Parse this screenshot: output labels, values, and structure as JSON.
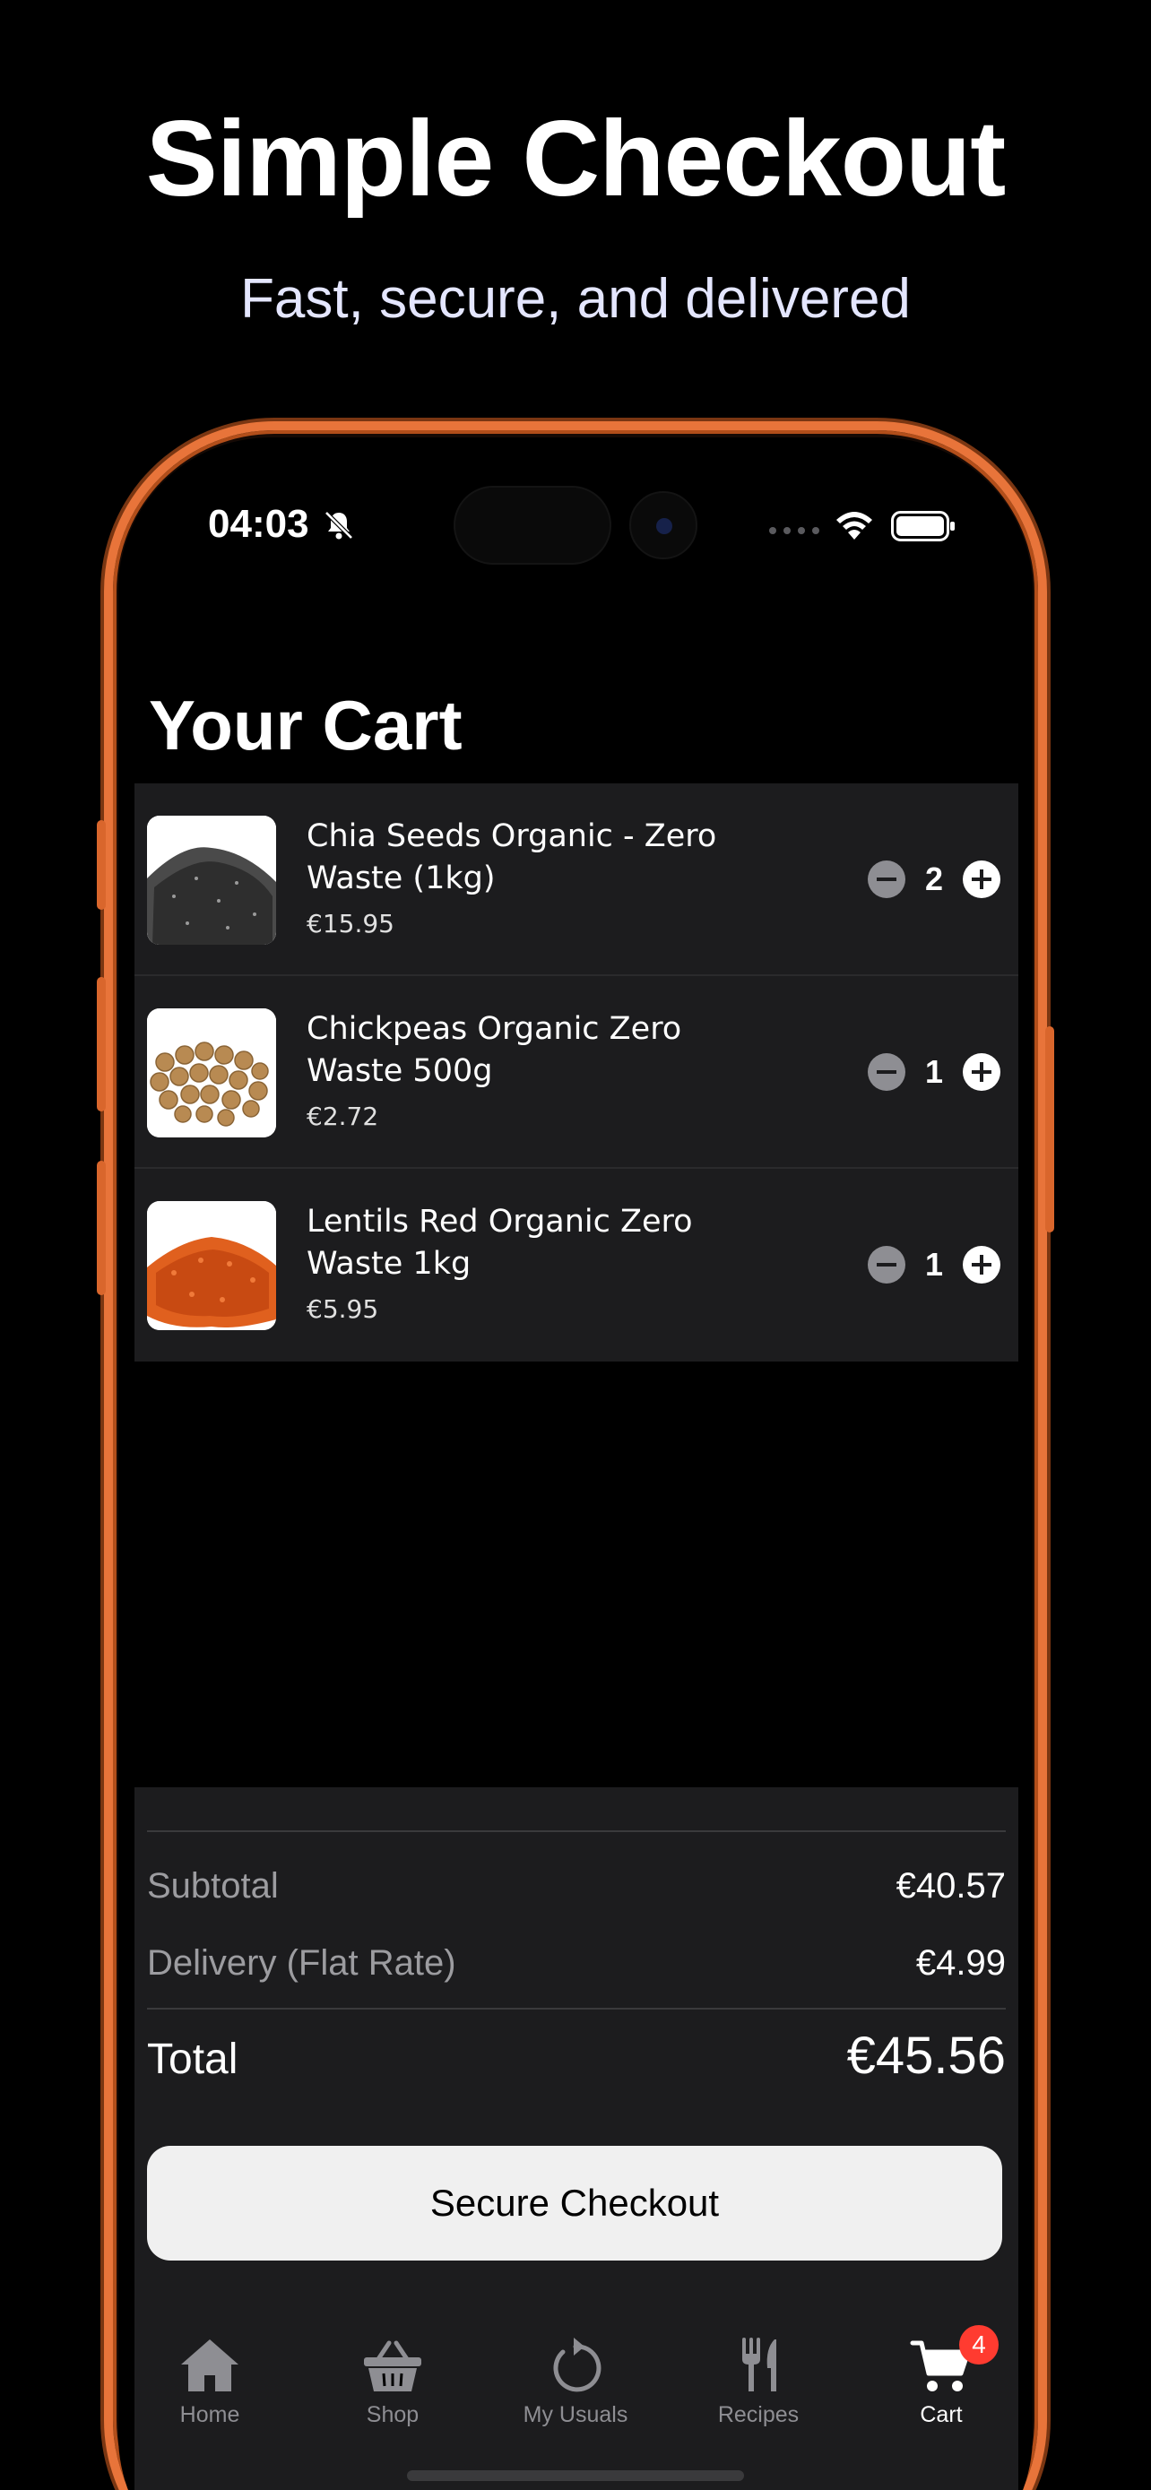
{
  "hero": {
    "title": "Simple Checkout",
    "subtitle": "Fast, secure, and delivered"
  },
  "status_bar": {
    "time": "04:03",
    "silent_icon": "bell-slash-icon",
    "signal_icon": "cellular-dots-icon",
    "wifi_icon": "wifi-icon",
    "battery_icon": "battery-full-icon"
  },
  "cart": {
    "title": "Your Cart",
    "items": [
      {
        "name": "Chia Seeds Organic - Zero Waste (1kg)",
        "price": "€15.95",
        "quantity": "2",
        "image": "chia-seeds-image"
      },
      {
        "name": "Chickpeas Organic Zero Waste 500g",
        "price": "€2.72",
        "quantity": "1",
        "image": "chickpeas-image"
      },
      {
        "name": "Lentils Red Organic Zero Waste 1kg",
        "price": "€5.95",
        "quantity": "1",
        "image": "red-lentils-image"
      }
    ]
  },
  "summary": {
    "subtotal_label": "Subtotal",
    "subtotal_value": "€40.57",
    "delivery_label": "Delivery (Flat Rate)",
    "delivery_value": "€4.99",
    "total_label": "Total",
    "total_value": "€45.56",
    "checkout_label": "Secure Checkout"
  },
  "tabbar": {
    "tabs": [
      {
        "label": "Home",
        "icon": "house-icon"
      },
      {
        "label": "Shop",
        "icon": "basket-icon"
      },
      {
        "label": "My Usuals",
        "icon": "refresh-icon"
      },
      {
        "label": "Recipes",
        "icon": "fork-knife-icon"
      },
      {
        "label": "Cart",
        "icon": "cart-icon",
        "badge": "4",
        "active": true
      }
    ]
  },
  "colors": {
    "frame": "#e8743a",
    "card": "#1c1c1e",
    "badge": "#ff3b30",
    "muted": "#8e8e93"
  }
}
